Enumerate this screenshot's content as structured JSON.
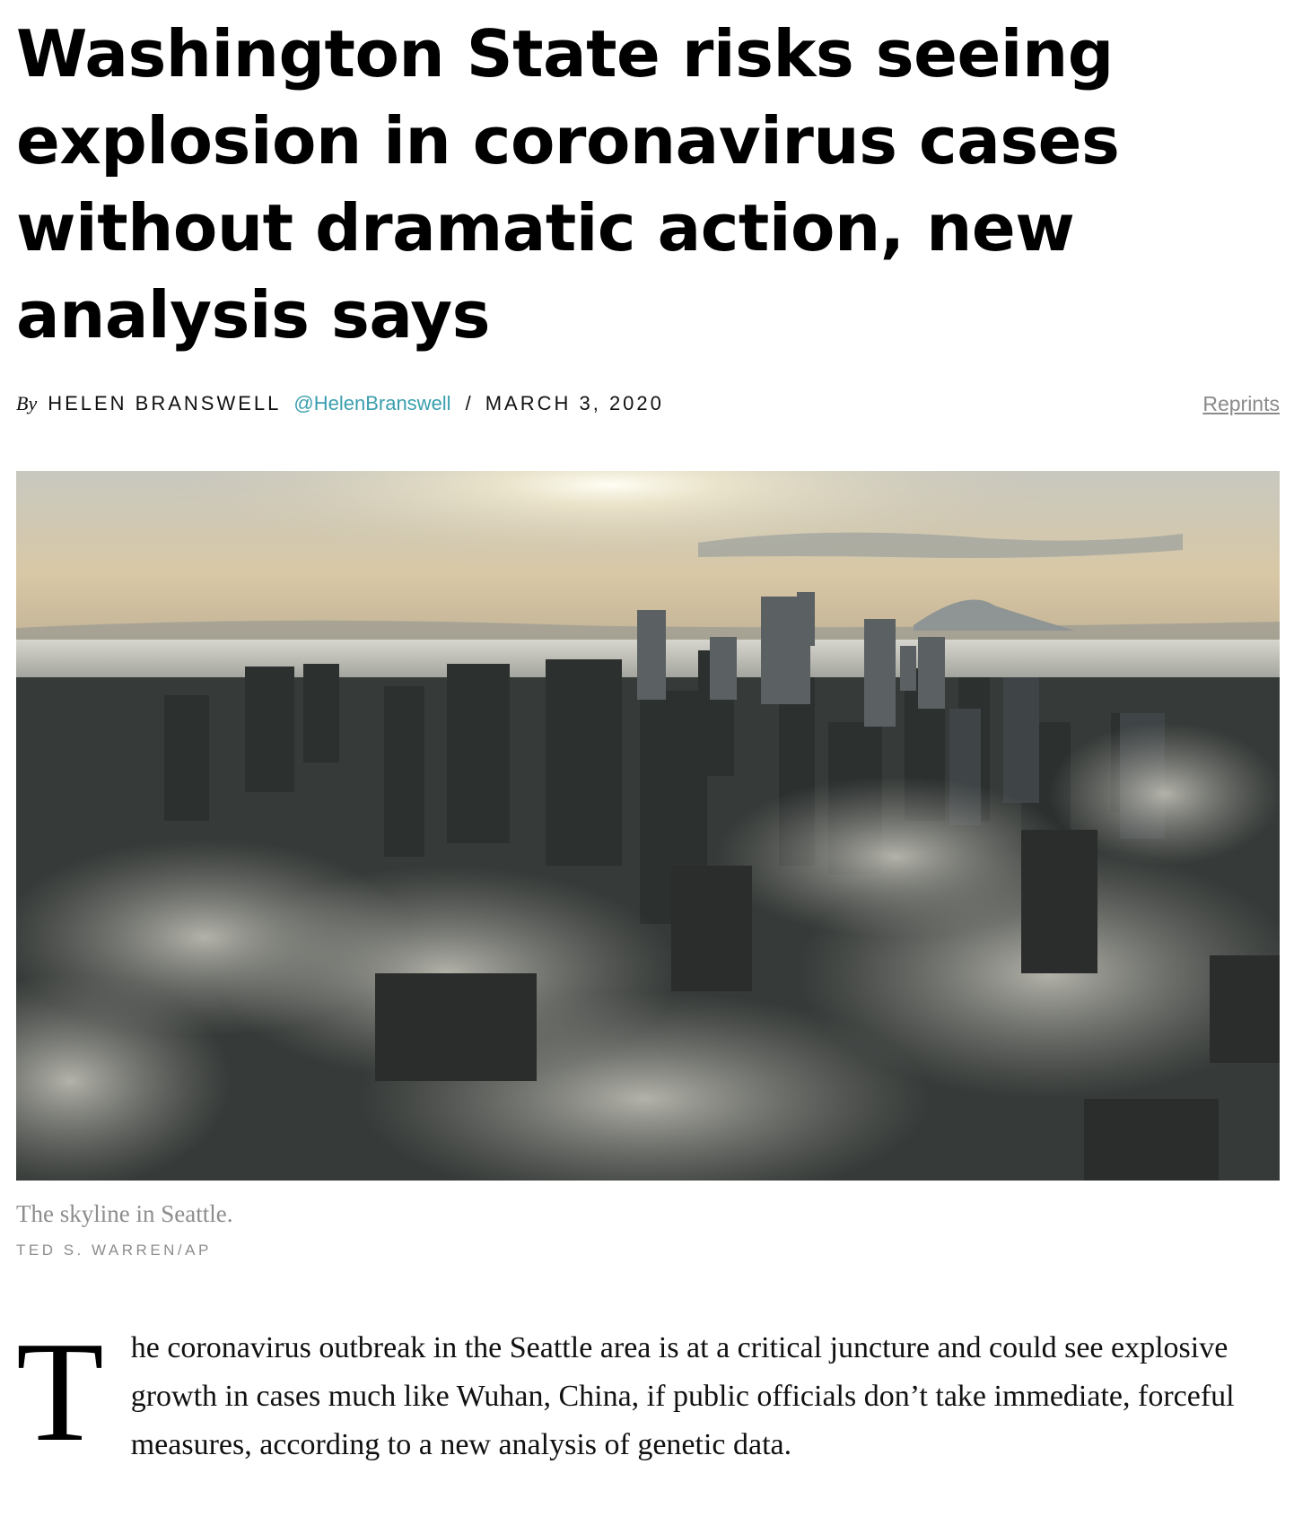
{
  "article": {
    "headline": "Washington State risks seeing explosion in coronavirus cases without dramatic action, new analysis says",
    "byline": {
      "by": "By",
      "author": "HELEN BRANSWELL",
      "handle": "@HelenBranswell",
      "separator": "/",
      "date": "MARCH 3, 2020",
      "reprints": "Reprints"
    },
    "photo": {
      "caption": "The skyline in Seattle.",
      "credit": "TED S. WARREN/AP"
    },
    "body": {
      "drop_cap": "T",
      "paragraph": "he coronavirus outbreak in the Seattle area is at a critical juncture and could see explosive growth in cases much like Wuhan, China, if public officials don’t take immediate, forceful measures, according to a new analysis of genetic data."
    }
  },
  "colors": {
    "handle": "#3a9fae",
    "muted": "#8d8d8d",
    "text": "#111111"
  }
}
